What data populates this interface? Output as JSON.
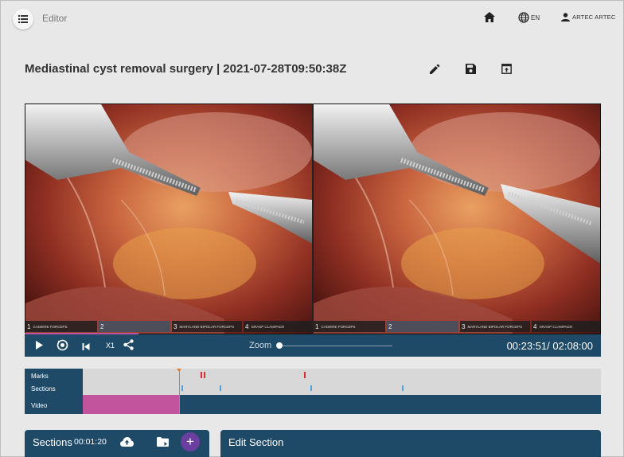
{
  "header": {
    "app_title": "Editor",
    "language": "EN",
    "user": "ARTEC ARTEC",
    "icons": [
      "menu-icon",
      "home-icon",
      "globe-icon",
      "person-icon"
    ]
  },
  "page": {
    "title": "Mediastinal cyst removal surgery | 2021-07-28T09:50:38Z",
    "actions": [
      "edit-icon",
      "save-icon",
      "open-in-window-icon"
    ]
  },
  "video": {
    "overlay_left": [
      {
        "num": "1",
        "text": "CADIERE FORCEPS"
      },
      {
        "num": "2",
        "text": ""
      },
      {
        "num": "3",
        "text": "MARYLAND BIPOLAR FORCEPS"
      },
      {
        "num": "4",
        "text": "GRASP CLAMPADO"
      }
    ],
    "overlay_right": [
      {
        "num": "1",
        "text": "CADIERE FORCEPS"
      },
      {
        "num": "2",
        "text": ""
      },
      {
        "num": "3",
        "text": "MARYLAND BIPOLAR FORCEPS"
      },
      {
        "num": "4",
        "text": "GRASP CLAMPADO"
      }
    ],
    "progress_fraction": 0.198
  },
  "controls": {
    "speed": "X1",
    "zoom_label": "Zoom",
    "zoom_value": 0,
    "time": "00:23:51/ 02:08:00"
  },
  "timeline": {
    "labels": {
      "marks": "Marks",
      "sections": "Sections",
      "video": "Video"
    },
    "playhead_fraction": 0.186,
    "marks_fractions": [
      0.227,
      0.233,
      0.427
    ],
    "section_fractions": [
      0.19,
      0.264,
      0.439,
      0.616
    ],
    "video_fill_fraction": 0.186
  },
  "panels": {
    "sections_title": "Sections",
    "sections_time": "00:01:20",
    "edit_title": "Edit Section"
  },
  "colors": {
    "brand_dark": "#1e4a68",
    "accent_pink": "#c2549d",
    "accent_purple": "#6b3fa0",
    "mark_red": "#d32f2f",
    "section_blue": "#4fa3e0",
    "playhead_orange": "#e07b2a"
  }
}
